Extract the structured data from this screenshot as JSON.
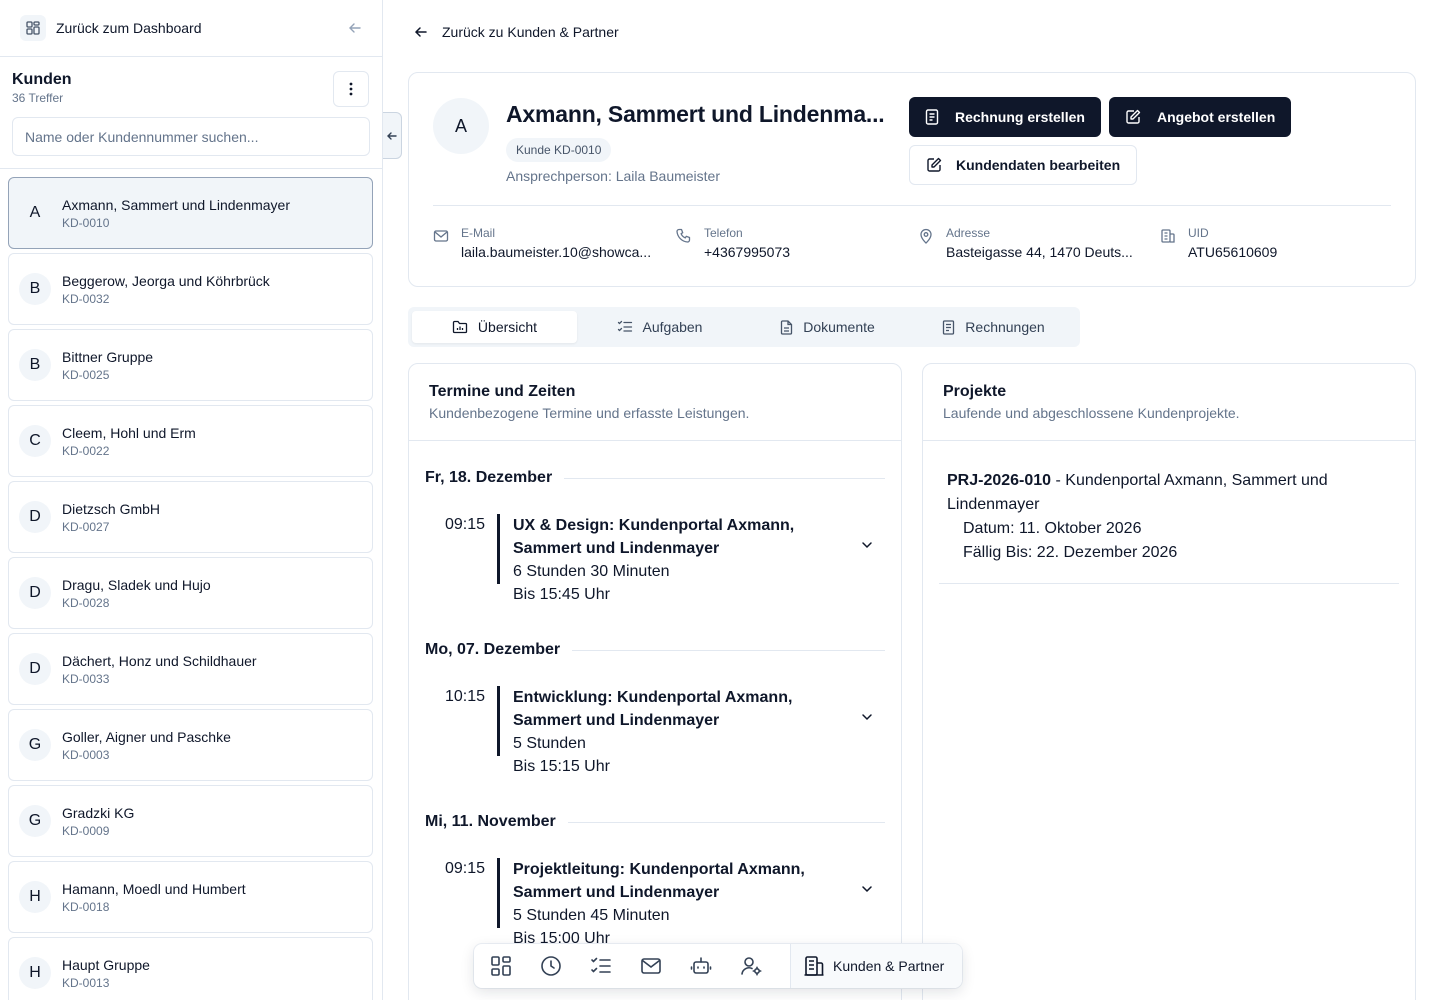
{
  "sidebar": {
    "back_label": "Zurück zum Dashboard",
    "title": "Kunden",
    "count": "36 Treffer",
    "search_placeholder": "Name oder Kundennummer suchen...",
    "customers": [
      {
        "initial": "A",
        "name": "Axmann, Sammert und Lindenmayer",
        "id": "KD-0010"
      },
      {
        "initial": "B",
        "name": "Beggerow, Jeorga und Köhrbrück",
        "id": "KD-0032"
      },
      {
        "initial": "B",
        "name": "Bittner Gruppe",
        "id": "KD-0025"
      },
      {
        "initial": "C",
        "name": "Cleem, Hohl und Erm",
        "id": "KD-0022"
      },
      {
        "initial": "D",
        "name": "Dietzsch GmbH",
        "id": "KD-0027"
      },
      {
        "initial": "D",
        "name": "Dragu, Sladek und Hujo",
        "id": "KD-0028"
      },
      {
        "initial": "D",
        "name": "Dächert, Honz und Schildhauer",
        "id": "KD-0033"
      },
      {
        "initial": "G",
        "name": "Goller, Aigner und Paschke",
        "id": "KD-0003"
      },
      {
        "initial": "G",
        "name": "Gradzki KG",
        "id": "KD-0009"
      },
      {
        "initial": "H",
        "name": "Hamann, Moedl und Humbert",
        "id": "KD-0018"
      },
      {
        "initial": "H",
        "name": "Haupt Gruppe",
        "id": "KD-0013"
      }
    ]
  },
  "main": {
    "back_label": "Zurück zu Kunden & Partner",
    "customer": {
      "initial": "A",
      "title": "Axmann, Sammert und Lindenma...",
      "badge": "Kunde KD-0010",
      "contact": "Ansprechperson: Laila Baumeister"
    },
    "actions": {
      "invoice": "Rechnung erstellen",
      "offer": "Angebot erstellen",
      "edit": "Kundendaten bearbeiten"
    },
    "info": {
      "email_label": "E-Mail",
      "email_value": "laila.baumeister.10@showca...",
      "phone_label": "Telefon",
      "phone_value": "+4367995073",
      "address_label": "Adresse",
      "address_value": "Basteigasse 44, 1470 Deuts...",
      "uid_label": "UID",
      "uid_value": "ATU65610609"
    },
    "tabs": [
      "Übersicht",
      "Aufgaben",
      "Dokumente",
      "Rechnungen"
    ],
    "appointments": {
      "title": "Termine und Zeiten",
      "subtitle": "Kundenbezogene Termine und erfasste Leistungen.",
      "days": [
        {
          "date": "Fr, 18. Dezember",
          "time": "09:15",
          "title": "UX & Design: Kundenportal Axmann, Sammert und Lindenmayer",
          "duration": "6 Stunden 30 Minuten",
          "until": "Bis 15:45 Uhr"
        },
        {
          "date": "Mo, 07. Dezember",
          "time": "10:15",
          "title": "Entwicklung: Kundenportal Axmann, Sammert und Lindenmayer",
          "duration": "5 Stunden",
          "until": "Bis 15:15 Uhr"
        },
        {
          "date": "Mi, 11. November",
          "time": "09:15",
          "title": "Projektleitung: Kundenportal Axmann, Sammert und Lindenmayer",
          "duration": "5 Stunden 45 Minuten",
          "until": "Bis 15:00 Uhr"
        }
      ]
    },
    "projects": {
      "title": "Projekte",
      "subtitle": "Laufende und abgeschlossene Kundenprojekte.",
      "items": [
        {
          "code": "PRJ-2026-010",
          "sep": " - ",
          "name": "Kundenportal Axmann, Sammert und Lindenmayer",
          "date": "Datum: 11. Oktober 2026",
          "due": "Fällig Bis: 22. Dezember 2026"
        }
      ]
    }
  },
  "dock": {
    "active_label": "Kunden & Partner"
  }
}
